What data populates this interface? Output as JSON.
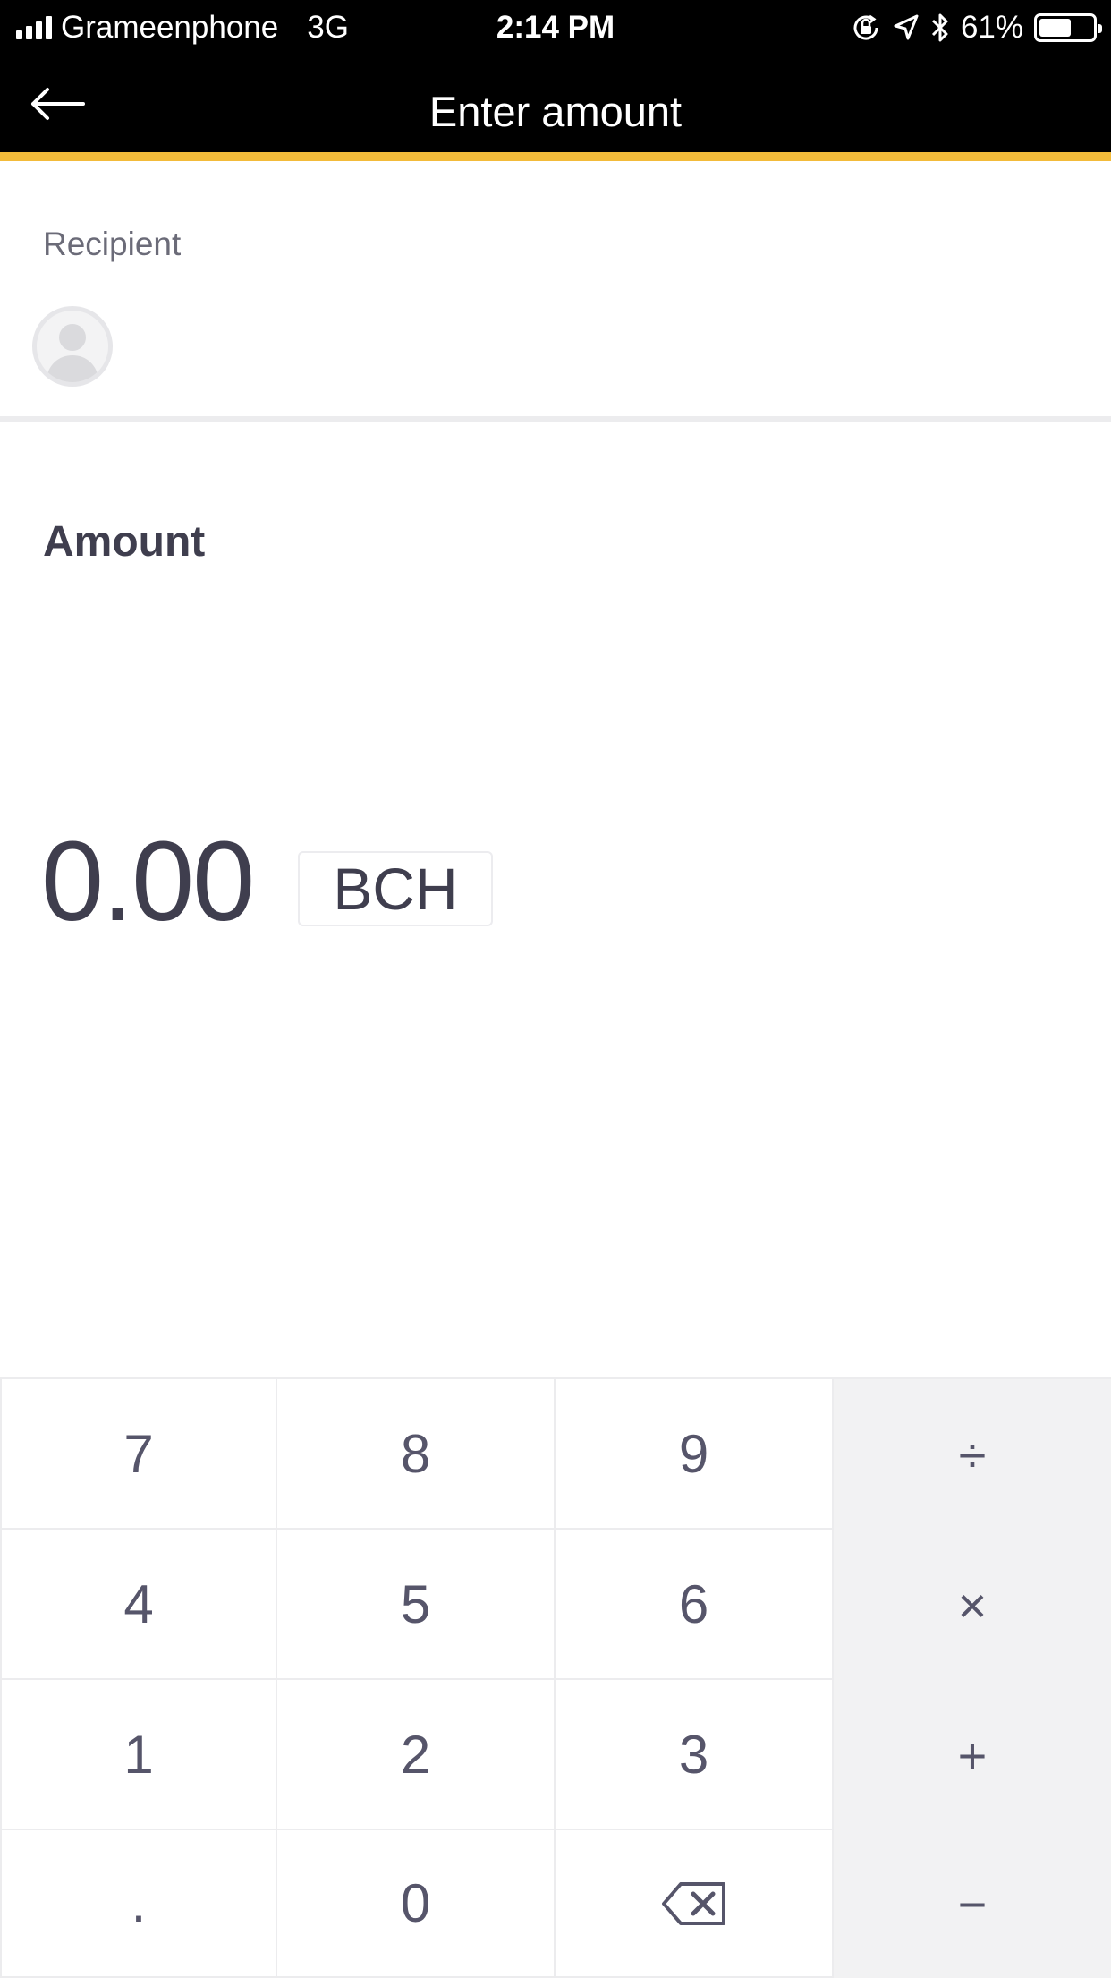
{
  "status_bar": {
    "carrier": "Grameenphone",
    "network": "3G",
    "time": "2:14 PM",
    "battery": "61%",
    "battery_level": 0.61,
    "icons": [
      "signal-icon",
      "orientation-lock-icon",
      "location-icon",
      "bluetooth-icon",
      "battery-icon"
    ]
  },
  "nav": {
    "title": "Enter amount",
    "back_icon": "arrow-left-icon"
  },
  "colors": {
    "accent": "#f3bb3a",
    "text": "#3f3e4e",
    "header": "#000000"
  },
  "recipient": {
    "label": "Recipient",
    "avatar_icon": "user-avatar-icon"
  },
  "amount": {
    "label": "Amount",
    "value": "0.00",
    "currency": "BCH"
  },
  "keypad": {
    "keys": [
      "7",
      "8",
      "9",
      "÷",
      "4",
      "5",
      "6",
      "×",
      "1",
      "2",
      "3",
      "+",
      ".",
      "0",
      "⌫",
      "−"
    ]
  }
}
